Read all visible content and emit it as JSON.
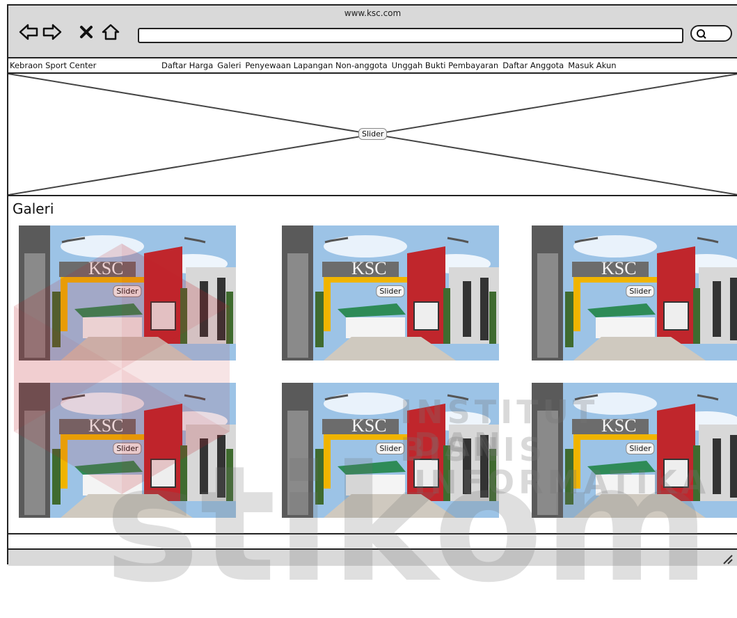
{
  "browser": {
    "url": "www.ksc.com",
    "icons": [
      "back-icon",
      "forward-icon",
      "close-icon",
      "home-icon",
      "search-icon"
    ]
  },
  "nav": {
    "brand": "Kebraon Sport Center",
    "items": [
      "Daftar Harga",
      "Galeri",
      "Penyewaan Lapangan Non-anggota",
      "Unggah Bukti Pembayaran",
      "Daftar Anggota",
      "Masuk Akun"
    ]
  },
  "hero": {
    "label": "Slider"
  },
  "gallery": {
    "title": "Galeri",
    "items": [
      {
        "label": "Slider",
        "sign": "KSC"
      },
      {
        "label": "Slider",
        "sign": "KSC"
      },
      {
        "label": "Slider",
        "sign": "KSC"
      },
      {
        "label": "Slider",
        "sign": "KSC"
      },
      {
        "label": "Slider",
        "sign": "KSC"
      },
      {
        "label": "Slider",
        "sign": "KSC"
      }
    ]
  },
  "watermark": {
    "line1": "INSTITUT BISNIS",
    "line2": "DAN INFORMATIKA",
    "big": "stikom"
  },
  "colors": {
    "chrome": "#d9d9d9",
    "sky": "#9cc3e6",
    "building_red": "#c0262c",
    "roof_green": "#2e8b57"
  }
}
